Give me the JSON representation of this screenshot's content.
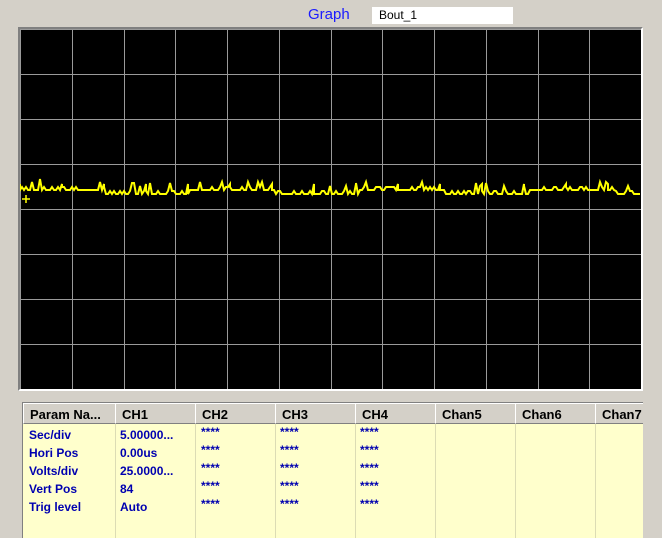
{
  "graph": {
    "label": "Graph",
    "name": "Bout_1"
  },
  "colors": {
    "trace": "#ffff00",
    "grid": "#9a9a9a",
    "screen": "#000000",
    "panel": "#ffffcc",
    "param_text": "#0000b0"
  },
  "params": {
    "headers": [
      "Param Na...",
      "CH1",
      "CH2",
      "CH3",
      "CH4",
      "Chan5",
      "Chan6",
      "Chan7"
    ],
    "rows": [
      {
        "name": "Sec/div",
        "ch1": "5.00000...",
        "ch2": "****",
        "ch3": "****",
        "ch4": "****"
      },
      {
        "name": "Hori Pos",
        "ch1": "0.00us",
        "ch2": "****",
        "ch3": "****",
        "ch4": "****"
      },
      {
        "name": "Volts/div",
        "ch1": "25.0000...",
        "ch2": "****",
        "ch3": "****",
        "ch4": "****"
      },
      {
        "name": "Vert Pos",
        "ch1": "84",
        "ch2": "****",
        "ch3": "****",
        "ch4": "****"
      },
      {
        "name": "Trig level",
        "ch1": "Auto",
        "ch2": "****",
        "ch3": "****",
        "ch4": "****"
      }
    ]
  }
}
